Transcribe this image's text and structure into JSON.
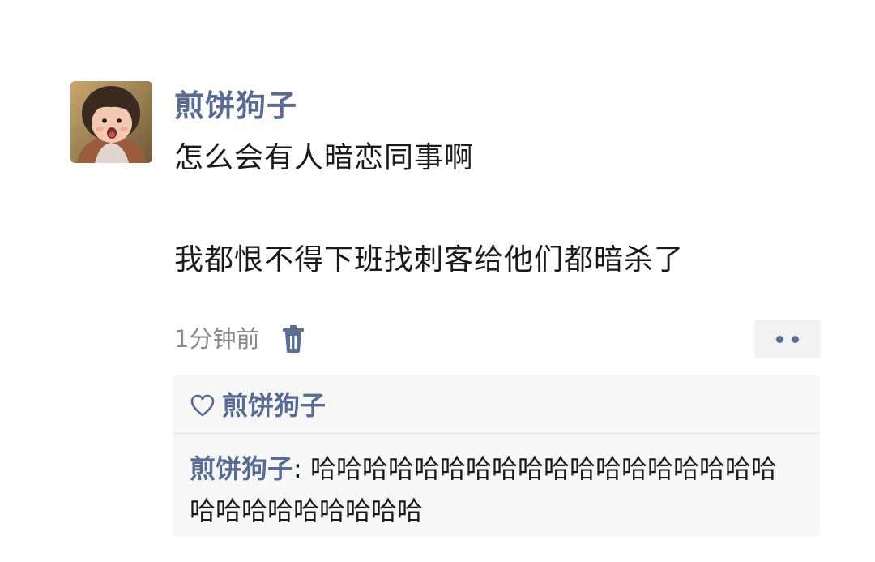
{
  "post": {
    "author": "煎饼狗子",
    "text_line1": "怎么会有人暗恋同事啊",
    "text_line2": "我都恨不得下班找刺客给他们都暗杀了",
    "timestamp": "1分钟前"
  },
  "icons": {
    "delete": "trash-icon",
    "more": "more-dots-icon",
    "like": "heart-outline-icon"
  },
  "likes": {
    "names": "煎饼狗子"
  },
  "comments": [
    {
      "author": "煎饼狗子",
      "separator": ": ",
      "text": "哈哈哈哈哈哈哈哈哈哈哈哈哈哈哈哈哈哈哈哈哈哈哈哈哈哈哈"
    }
  ],
  "colors": {
    "name_link": "#576b95",
    "timestamp": "#8a8a8a",
    "panel_bg": "#f7f7f7"
  }
}
